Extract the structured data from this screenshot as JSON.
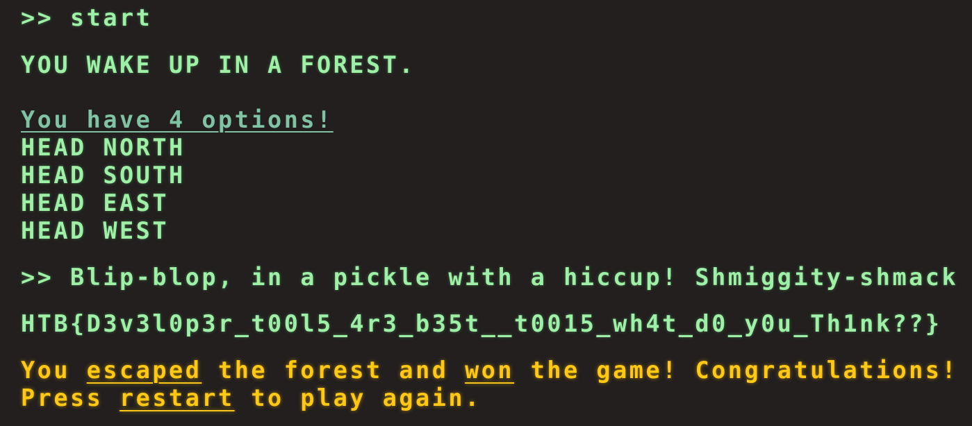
{
  "terminal": {
    "command_1": ">> start",
    "scene_text": "YOU WAKE UP IN A FOREST.",
    "options_header": "You have 4 options!",
    "options": [
      "HEAD NORTH",
      "HEAD SOUTH",
      "HEAD EAST",
      "HEAD WEST"
    ],
    "command_2": ">> Blip-blop, in a pickle with a hiccup! Shmiggity-shmack",
    "flag": "HTB{D3v3l0p3r_t00l5_4r3_b35t__t0015_wh4t_d0_y0u_Th1nk??}",
    "win_message": {
      "line1": {
        "part1": "You ",
        "link_escaped": "escaped",
        "part2": " the forest and ",
        "link_won": "won",
        "part3": " the game! Congratulations!"
      },
      "line2": {
        "part1": "Press ",
        "link_restart": "restart",
        "part2": " to play again."
      }
    }
  },
  "colors": {
    "background": "#221f1e",
    "terminal_text": "#9ef0a6",
    "options_header": "#7fc2a4",
    "win_text": "#ffc814"
  }
}
